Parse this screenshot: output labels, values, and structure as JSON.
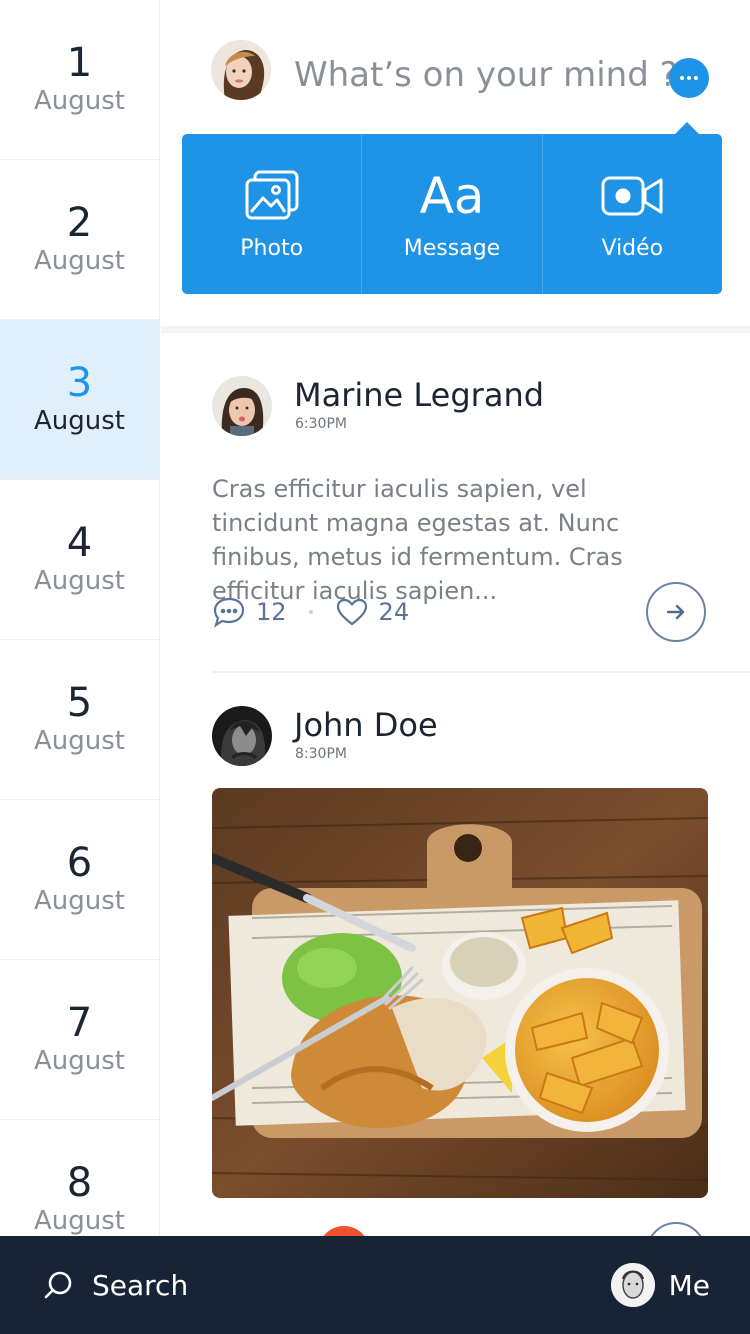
{
  "dates": [
    {
      "day": "1",
      "month": "August"
    },
    {
      "day": "2",
      "month": "August"
    },
    {
      "day": "3",
      "month": "August"
    },
    {
      "day": "4",
      "month": "August"
    },
    {
      "day": "5",
      "month": "August"
    },
    {
      "day": "6",
      "month": "August"
    },
    {
      "day": "7",
      "month": "August"
    },
    {
      "day": "8",
      "month": "August"
    }
  ],
  "active_date_index": 2,
  "composer": {
    "placeholder": "What’s on your mind ?",
    "actions": [
      {
        "label": "Photo",
        "icon": "photo-icon"
      },
      {
        "label": "Message",
        "icon_text": "Aa",
        "icon": "text-icon"
      },
      {
        "label": "Vidéo",
        "icon": "video-camera-icon"
      }
    ]
  },
  "posts": [
    {
      "author": "Marine Legrand",
      "time": "6:30PM",
      "text": "Cras efficitur iaculis sapien, vel tincidunt magna egestas at. Nunc finibus, metus id fermentum. Cras efficitur iaculis sapien...",
      "comments": "12",
      "likes": "24"
    },
    {
      "author": "John Doe",
      "time": "8:30PM",
      "image": "fish-and-chips-photo"
    }
  ],
  "bottom_bar": {
    "search_label": "Search",
    "me_label": "Me"
  },
  "colors": {
    "accent": "#1f93e6",
    "dark_bar": "#172436",
    "active_date_bg": "#dff0fc",
    "text_dark": "#1c2533",
    "text_muted": "#8a9099",
    "stat_blue": "#5a7499"
  }
}
